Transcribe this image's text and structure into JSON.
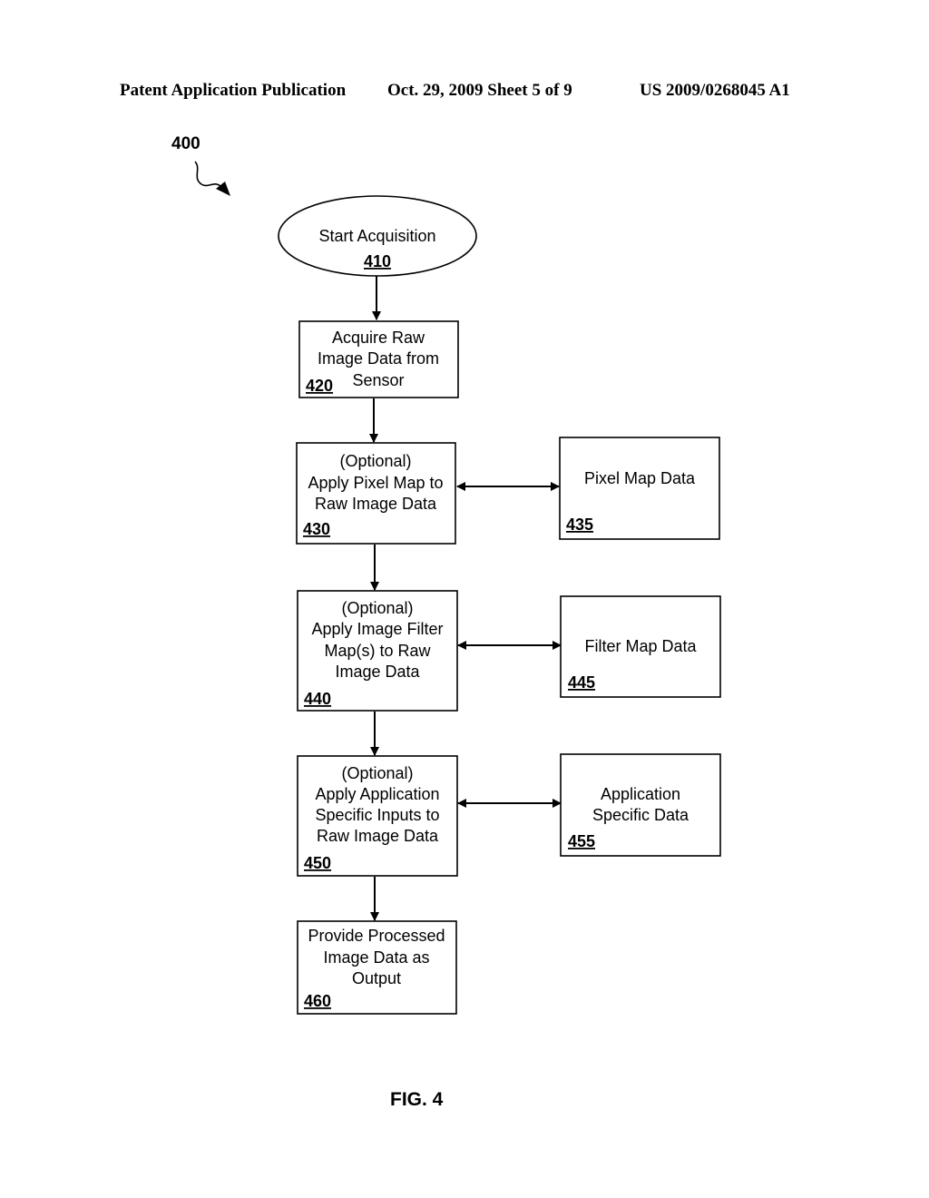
{
  "header": {
    "publication": "Patent Application Publication",
    "date_sheet": "Oct. 29, 2009   Sheet 5 of 9",
    "number": "US 2009/0268045 A1"
  },
  "figure": {
    "ref": "400",
    "label": "FIG. 4"
  },
  "nodes": {
    "n410": {
      "lines": [
        "Start Acquisition"
      ],
      "ref": "410",
      "shape": "ellipse"
    },
    "n420": {
      "lines": [
        "Acquire Raw",
        "Image Data from",
        "Sensor"
      ],
      "ref": "420",
      "shape": "rect"
    },
    "n430": {
      "lines": [
        "(Optional)",
        "Apply Pixel Map to",
        "Raw Image Data"
      ],
      "ref": "430",
      "shape": "rect"
    },
    "n435": {
      "lines": [
        "Pixel Map Data"
      ],
      "ref": "435",
      "shape": "rect"
    },
    "n440": {
      "lines": [
        "(Optional)",
        "Apply Image Filter",
        "Map(s) to Raw",
        "Image Data"
      ],
      "ref": "440",
      "shape": "rect"
    },
    "n445": {
      "lines": [
        "Filter Map Data"
      ],
      "ref": "445",
      "shape": "rect"
    },
    "n450": {
      "lines": [
        "(Optional)",
        "Apply Application",
        "Specific Inputs to",
        "Raw Image Data"
      ],
      "ref": "450",
      "shape": "rect"
    },
    "n455": {
      "lines": [
        "Application",
        "Specific Data"
      ],
      "ref": "455",
      "shape": "rect"
    },
    "n460": {
      "lines": [
        "Provide Processed",
        "Image Data as",
        "Output"
      ],
      "ref": "460",
      "shape": "rect"
    }
  },
  "edges": [
    {
      "from": "410",
      "to": "420",
      "type": "directed"
    },
    {
      "from": "420",
      "to": "430",
      "type": "directed"
    },
    {
      "from": "430",
      "to": "440",
      "type": "directed"
    },
    {
      "from": "440",
      "to": "450",
      "type": "directed"
    },
    {
      "from": "450",
      "to": "460",
      "type": "directed"
    },
    {
      "from": "430",
      "to": "435",
      "type": "bidirectional"
    },
    {
      "from": "440",
      "to": "445",
      "type": "bidirectional"
    },
    {
      "from": "450",
      "to": "455",
      "type": "bidirectional"
    }
  ]
}
